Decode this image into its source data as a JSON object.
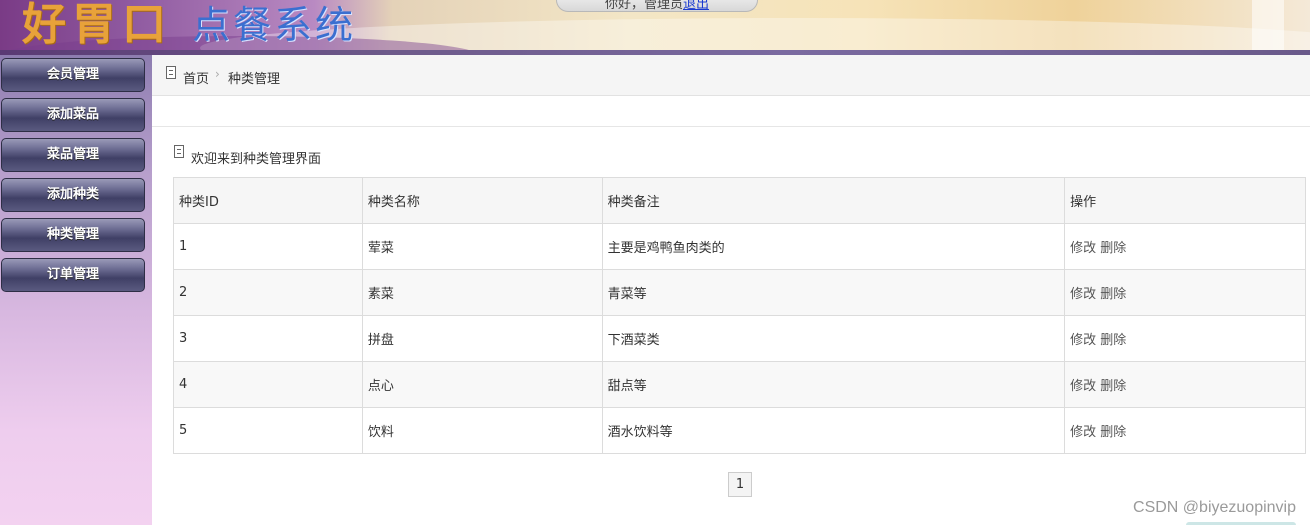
{
  "header": {
    "logo_main": "好胃口",
    "logo_sub": "点餐系统",
    "greeting": "你好，管理员",
    "logout_label": "退出"
  },
  "sidebar": {
    "items": [
      {
        "label": "会员管理"
      },
      {
        "label": "添加菜品"
      },
      {
        "label": "菜品管理"
      },
      {
        "label": "添加种类"
      },
      {
        "label": "种类管理"
      },
      {
        "label": "订单管理"
      }
    ]
  },
  "breadcrumb": {
    "home": "首页",
    "separator": "›",
    "current": "种类管理"
  },
  "welcome_text": "欢迎来到种类管理界面",
  "table": {
    "headers": [
      "种类ID",
      "种类名称",
      "种类备注",
      "操作"
    ],
    "rows": [
      {
        "id": "1",
        "name": "荤菜",
        "note": "主要是鸡鸭鱼肉类的",
        "edit": "修改",
        "delete": "删除"
      },
      {
        "id": "2",
        "name": "素菜",
        "note": "青菜等",
        "edit": "修改",
        "delete": "删除"
      },
      {
        "id": "3",
        "name": "拼盘",
        "note": "下酒菜类",
        "edit": "修改",
        "delete": "删除"
      },
      {
        "id": "4",
        "name": "点心",
        "note": "甜点等",
        "edit": "修改",
        "delete": "删除"
      },
      {
        "id": "5",
        "name": "饮料",
        "note": "酒水饮料等",
        "edit": "修改",
        "delete": "删除"
      }
    ]
  },
  "pagination": {
    "current_page": "1"
  },
  "watermark": "CSDN @biyezuopinvip",
  "colors": {
    "sidebar_button": "#404066",
    "logo_main": "#e8a23a",
    "logo_sub": "#3b6fd0",
    "link": "#1a3ad0"
  }
}
